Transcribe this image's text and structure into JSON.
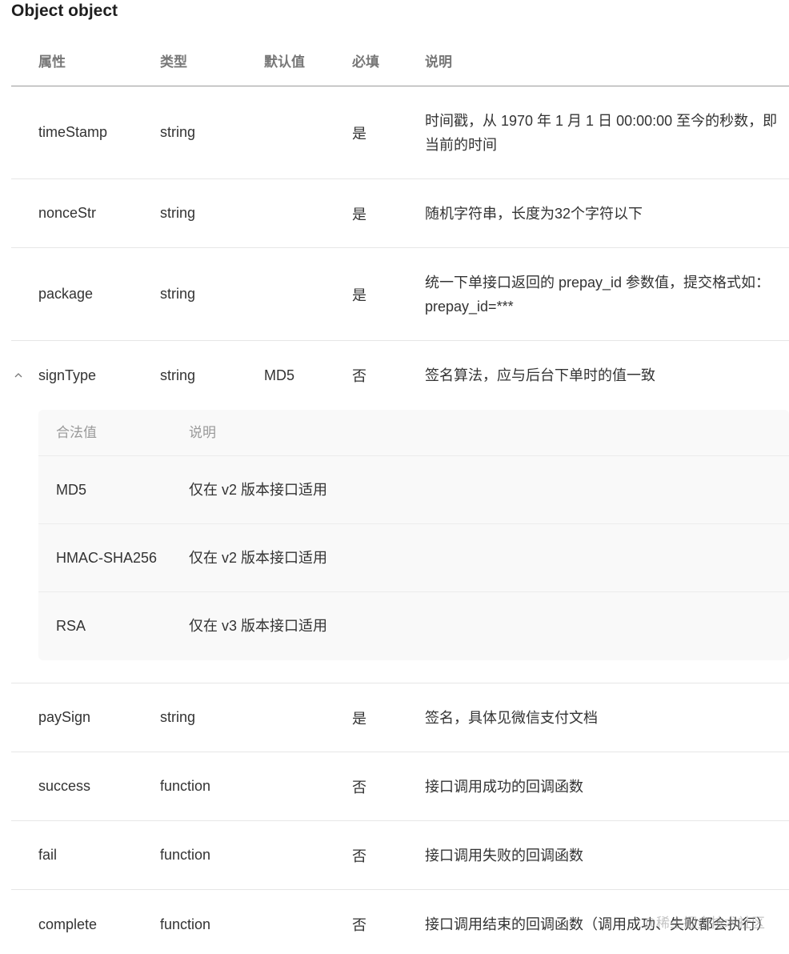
{
  "title": "Object object",
  "columns": {
    "name": "属性",
    "type": "类型",
    "default": "默认值",
    "required": "必填",
    "desc": "说明"
  },
  "rows": [
    {
      "name": "timeStamp",
      "type": "string",
      "default": "",
      "required": "是",
      "desc": "时间戳，从 1970 年 1 月 1 日 00:00:00 至今的秒数，即当前的时间"
    },
    {
      "name": "nonceStr",
      "type": "string",
      "default": "",
      "required": "是",
      "desc": "随机字符串，长度为32个字符以下"
    },
    {
      "name": "package",
      "type": "string",
      "default": "",
      "required": "是",
      "desc": "统一下单接口返回的 prepay_id 参数值，提交格式如：prepay_id=***"
    },
    {
      "name": "signType",
      "type": "string",
      "default": "MD5",
      "required": "否",
      "desc": "签名算法，应与后台下单时的值一致"
    },
    {
      "name": "paySign",
      "type": "string",
      "default": "",
      "required": "是",
      "desc": "签名，具体见微信支付文档"
    },
    {
      "name": "success",
      "type": "function",
      "default": "",
      "required": "否",
      "desc": "接口调用成功的回调函数"
    },
    {
      "name": "fail",
      "type": "function",
      "default": "",
      "required": "否",
      "desc": "接口调用失败的回调函数"
    },
    {
      "name": "complete",
      "type": "function",
      "default": "",
      "required": "否",
      "desc": "接口调用结束的回调函数（调用成功、失败都会执行）"
    }
  ],
  "signType_values": {
    "columns": {
      "value": "合法值",
      "desc": "说明"
    },
    "items": [
      {
        "value": "MD5",
        "desc": "仅在 v2 版本接口适用"
      },
      {
        "value": "HMAC-SHA256",
        "desc": "仅在 v2 版本接口适用"
      },
      {
        "value": "RSA",
        "desc": "仅在 v3 版本接口适用"
      }
    ]
  },
  "watermark": "@稀土掘金技术社区",
  "icons": {
    "expand": "chevron-up-icon"
  }
}
